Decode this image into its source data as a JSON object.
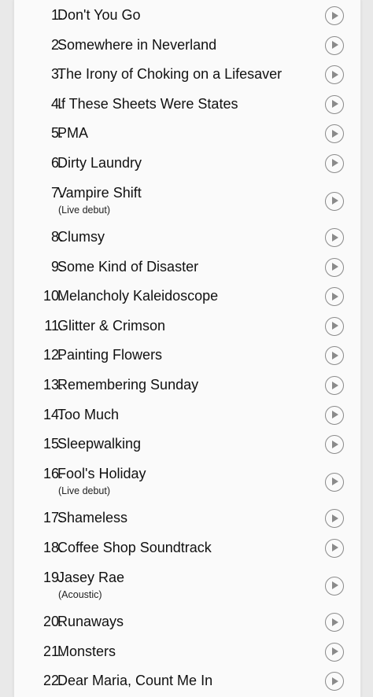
{
  "tracks": [
    {
      "number": "1.",
      "title": "Don't You Go",
      "note": "",
      "play_icon": "play-circle-icon"
    },
    {
      "number": "2.",
      "title": "Somewhere in Neverland",
      "note": "",
      "play_icon": "play-circle-icon"
    },
    {
      "number": "3.",
      "title": "The Irony of Choking on a Lifesaver",
      "note": "",
      "play_icon": "play-circle-icon"
    },
    {
      "number": "4.",
      "title": "If These Sheets Were States",
      "note": "",
      "play_icon": "play-circle-icon"
    },
    {
      "number": "5.",
      "title": "PMA",
      "note": "",
      "play_icon": "play-circle-icon"
    },
    {
      "number": "6.",
      "title": "Dirty Laundry",
      "note": "",
      "play_icon": "play-circle-icon"
    },
    {
      "number": "7.",
      "title": "Vampire Shift",
      "note": "(Live debut)",
      "play_icon": "play-circle-icon"
    },
    {
      "number": "8.",
      "title": "Clumsy",
      "note": "",
      "play_icon": "play-circle-icon"
    },
    {
      "number": "9.",
      "title": "Some Kind of Disaster",
      "note": "",
      "play_icon": "play-circle-icon"
    },
    {
      "number": "10.",
      "title": "Melancholy Kaleidoscope",
      "note": "",
      "play_icon": "play-circle-icon"
    },
    {
      "number": "11.",
      "title": "Glitter & Crimson",
      "note": "",
      "play_icon": "play-circle-icon"
    },
    {
      "number": "12.",
      "title": "Painting Flowers",
      "note": "",
      "play_icon": "play-circle-icon"
    },
    {
      "number": "13.",
      "title": "Remembering Sunday",
      "note": "",
      "play_icon": "play-circle-icon"
    },
    {
      "number": "14.",
      "title": "Too Much",
      "note": "",
      "play_icon": "play-circle-icon"
    },
    {
      "number": "15.",
      "title": "Sleepwalking",
      "note": "",
      "play_icon": "play-circle-icon"
    },
    {
      "number": "16.",
      "title": "Fool's Holiday",
      "note": "(Live debut)",
      "play_icon": "play-circle-icon"
    },
    {
      "number": "17.",
      "title": "Shameless",
      "note": "",
      "play_icon": "play-circle-icon"
    },
    {
      "number": "18.",
      "title": "Coffee Shop Soundtrack",
      "note": "",
      "play_icon": "play-circle-icon"
    },
    {
      "number": "19.",
      "title": "Jasey Rae",
      "note": "(Acoustic)",
      "play_icon": "play-circle-icon"
    },
    {
      "number": "20.",
      "title": "Runaways",
      "note": "",
      "play_icon": "play-circle-icon"
    },
    {
      "number": "21.",
      "title": "Monsters",
      "note": "",
      "play_icon": "play-circle-icon"
    },
    {
      "number": "22.",
      "title": "Dear Maria, Count Me In",
      "note": "",
      "play_icon": "play-circle-icon"
    }
  ],
  "colors": {
    "background": "#e9e9e9",
    "panel": "#fafafa",
    "text": "#111111",
    "icon": "#8a8a8a"
  }
}
